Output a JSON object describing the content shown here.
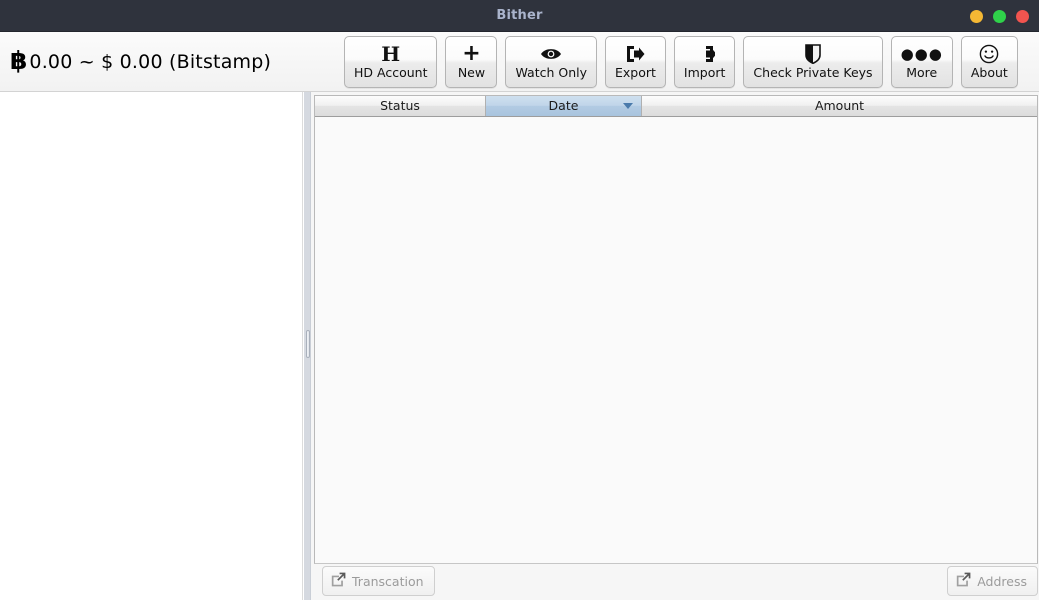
{
  "window": {
    "title": "Bither",
    "controls": [
      {
        "name": "minimize",
        "color": "#f5b834"
      },
      {
        "name": "maximize",
        "color": "#2fd24a"
      },
      {
        "name": "close",
        "color": "#f2544f"
      }
    ]
  },
  "balance": {
    "btc_symbol": "฿",
    "btc_amount": "0.00",
    "separator": "~",
    "fiat_symbol": "$",
    "fiat_amount": "0.00",
    "exchange": "(Bitstamp)",
    "full_text": "0.00  ~  $ 0.00 (Bitstamp)"
  },
  "toolbar": {
    "buttons": [
      {
        "label": "HD Account",
        "icon": "h-letter-icon",
        "glyph": "H"
      },
      {
        "label": "New",
        "icon": "plus-icon",
        "glyph": "+"
      },
      {
        "label": "Watch Only",
        "icon": "eye-icon",
        "glyph": ""
      },
      {
        "label": "Export",
        "icon": "export-arrow-icon",
        "glyph": ""
      },
      {
        "label": "Import",
        "icon": "import-arrow-icon",
        "glyph": ""
      },
      {
        "label": "Check Private Keys",
        "icon": "shield-icon",
        "glyph": ""
      },
      {
        "label": "More",
        "icon": "ellipsis-icon",
        "glyph": "●●●"
      },
      {
        "label": "About",
        "icon": "smiley-icon",
        "glyph": ""
      }
    ]
  },
  "transactions_table": {
    "columns": [
      {
        "label": "Status",
        "sorted": false,
        "sort_direction": ""
      },
      {
        "label": "Date",
        "sorted": true,
        "sort_direction": "descending"
      },
      {
        "label": "Amount",
        "sorted": false,
        "sort_direction": ""
      }
    ],
    "rows": [],
    "empty": true
  },
  "bottom_bar": {
    "transaction_button": {
      "label": "Transcation",
      "icon": "external-link-icon",
      "disabled": true
    },
    "address_button": {
      "label": "Address",
      "icon": "external-link-icon",
      "disabled": true
    }
  },
  "colors": {
    "titlebar_bg": "#2f333d",
    "titlebar_text": "#aab4cc",
    "sort_header_bg": "#b2cbe3",
    "sort_arrow": "#4a7aab",
    "disabled_text": "#9b9b9b"
  }
}
